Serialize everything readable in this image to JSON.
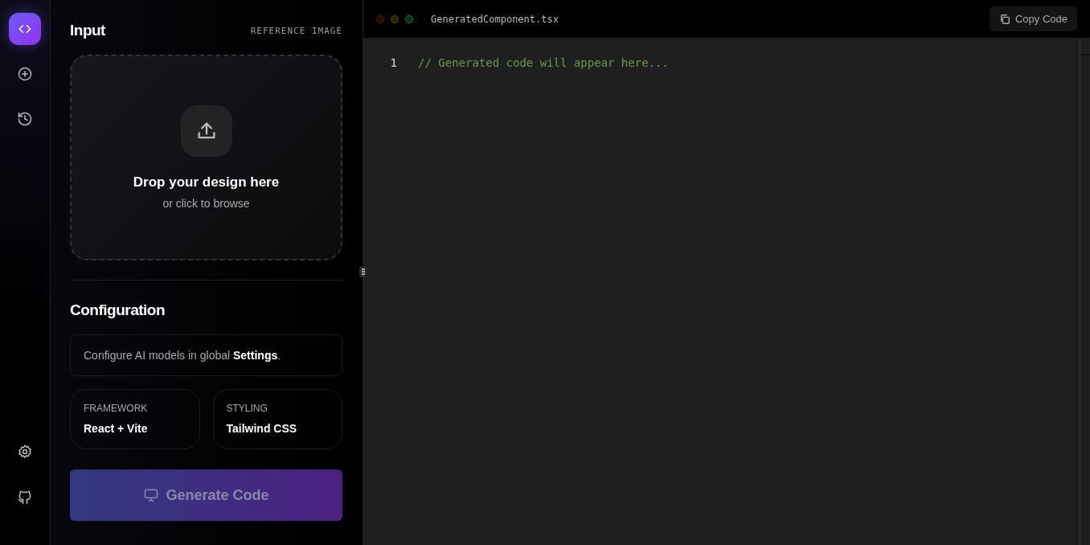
{
  "sidebar": {
    "items": [
      {
        "kind": "logo",
        "selected": true
      },
      {
        "kind": "new",
        "selected": false
      },
      {
        "kind": "history",
        "selected": false
      }
    ],
    "bottom_items": [
      {
        "kind": "settings"
      },
      {
        "kind": "github"
      }
    ]
  },
  "input": {
    "title": "Input",
    "subtitle": "REFERENCE IMAGE",
    "dropzone": {
      "title": "Drop your design here",
      "hint": "or click to browse"
    }
  },
  "configuration": {
    "title": "Configuration",
    "note": "Configure AI models in global **Settings**.",
    "options": [
      {
        "label": "FRAMEWORK",
        "value": "React + Vite"
      },
      {
        "label": "STYLING",
        "value": "Tailwind CSS"
      }
    ]
  },
  "generate_button": {
    "label": "Generate Code",
    "disabled": true
  },
  "editor": {
    "filename": "GeneratedComponent.tsx",
    "copy_button": "Copy Code",
    "lines": [
      {
        "number": "1",
        "code": "// Generated code will appear here..."
      }
    ]
  }
}
